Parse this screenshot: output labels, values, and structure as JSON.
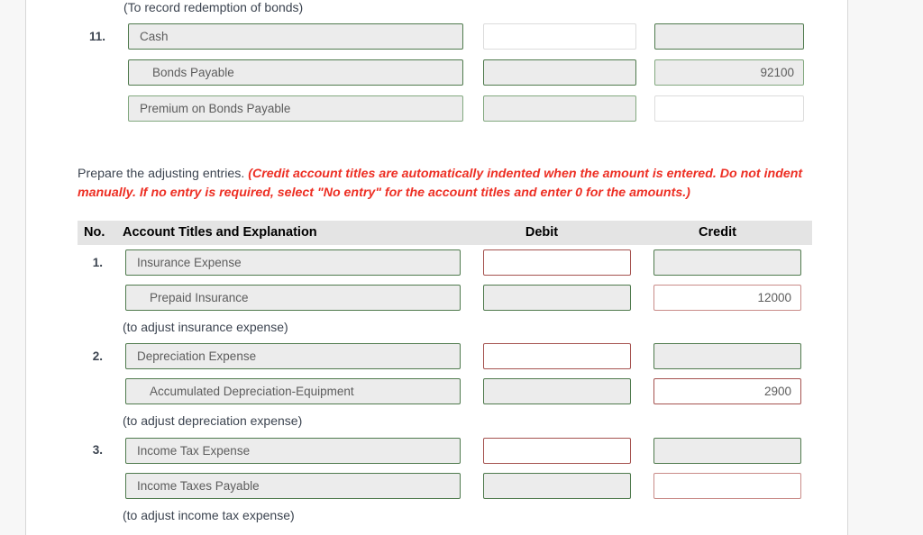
{
  "top_section": {
    "memo": "(To record redemption of bonds)",
    "entry_number": "11.",
    "lines": [
      {
        "account": "Cash",
        "indented": false,
        "debit": "",
        "credit": ""
      },
      {
        "account": "Bonds Payable",
        "indented": true,
        "debit": "",
        "credit": "92100"
      },
      {
        "account": "Premium on Bonds Payable",
        "indented": false,
        "debit": "",
        "credit": ""
      }
    ]
  },
  "instructions": {
    "lead": "Prepare the adjusting entries. ",
    "emphasis": "(Credit account titles are automatically indented when the amount is entered. Do not indent manually. If no entry is required, select \"No entry\" for the account titles and enter 0 for the amounts.)"
  },
  "table": {
    "headers": {
      "no": "No.",
      "account": "Account Titles and Explanation",
      "debit": "Debit",
      "credit": "Credit"
    },
    "entries": [
      {
        "number": "1.",
        "memo": "(to adjust insurance expense)",
        "lines": [
          {
            "account": "Insurance Expense",
            "indented": false,
            "debit": "",
            "credit": ""
          },
          {
            "account": "Prepaid Insurance",
            "indented": true,
            "debit": "",
            "credit": "12000"
          }
        ]
      },
      {
        "number": "2.",
        "memo": "(to adjust depreciation expense)",
        "lines": [
          {
            "account": "Depreciation Expense",
            "indented": false,
            "debit": "",
            "credit": ""
          },
          {
            "account": "Accumulated Depreciation-Equipment",
            "indented": true,
            "debit": "",
            "credit": "2900"
          }
        ]
      },
      {
        "number": "3.",
        "memo": "(to adjust income tax expense)",
        "lines": [
          {
            "account": "Income Tax Expense",
            "indented": false,
            "debit": "",
            "credit": ""
          },
          {
            "account": "Income Taxes Payable",
            "indented": false,
            "debit": "",
            "credit": ""
          }
        ]
      }
    ]
  },
  "colors": {
    "accent_red": "#ed2f24",
    "field_green_border": "#4f7a4d",
    "field_red_border": "#a5524f",
    "field_fill": "#ececec",
    "header_fill": "#e4e4e4"
  }
}
